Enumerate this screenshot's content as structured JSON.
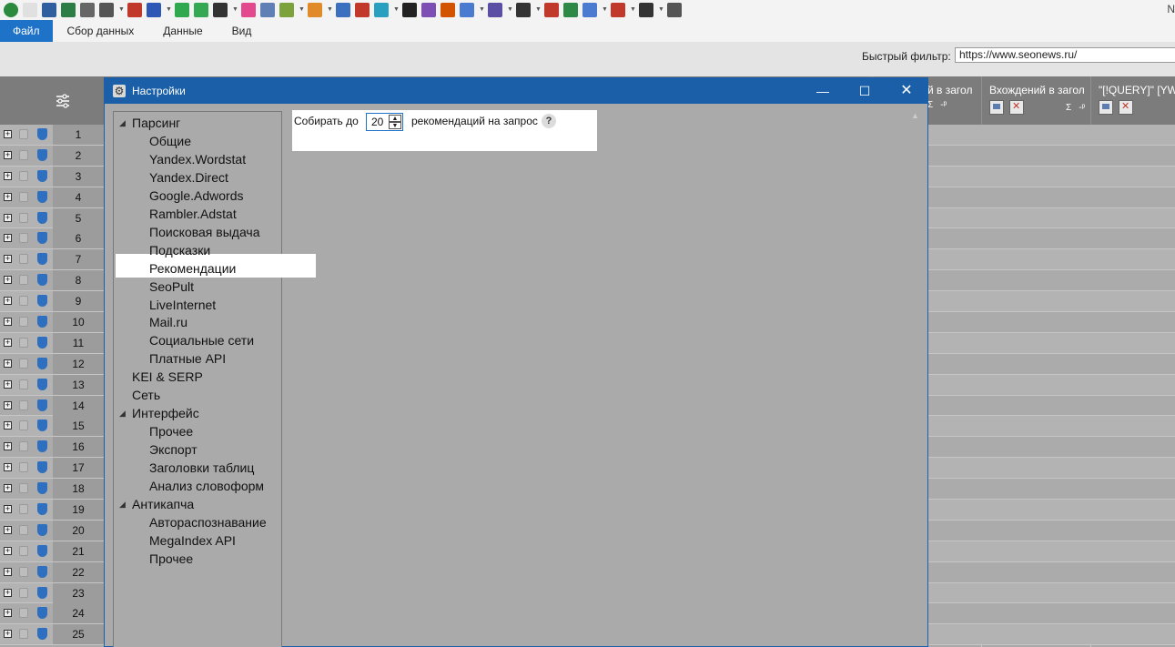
{
  "toolbar": {
    "icons": [
      {
        "name": "app-drop-icon",
        "color": "#2b8a3e"
      },
      {
        "name": "new-file-icon",
        "color": "#e0e0e0"
      },
      {
        "name": "save-icon",
        "color": "#2f5f9e"
      },
      {
        "name": "excel-icon",
        "color": "#2d7d46"
      },
      {
        "name": "settings-icon",
        "color": "#666666"
      },
      {
        "name": "magic-wand-icon",
        "color": "#555555"
      },
      {
        "name": "bar-chart-red-icon",
        "color": "#c0392b"
      },
      {
        "name": "bar-chart-blue-icon",
        "color": "#2d58b5"
      },
      {
        "name": "add-circle-icon",
        "color": "#2fa84f"
      },
      {
        "name": "google-g-icon",
        "color": "#34a853"
      },
      {
        "name": "r-icon",
        "color": "#333333"
      },
      {
        "name": "colors-icon",
        "color": "#e24a8d"
      },
      {
        "name": "image-icon",
        "color": "#5f7fb5"
      },
      {
        "name": "target-icon",
        "color": "#7ca33b"
      },
      {
        "name": "hand-icon",
        "color": "#e08a2a"
      },
      {
        "name": "shield-check-icon",
        "color": "#3b6fc0"
      },
      {
        "name": "block-icon",
        "color": "#c0392b"
      },
      {
        "name": "monitor-icon",
        "color": "#2aa0c0"
      },
      {
        "name": "li-icon",
        "color": "#222222"
      },
      {
        "name": "stats-purple-icon",
        "color": "#7d4fb5"
      },
      {
        "name": "trend-icon",
        "color": "#d35400"
      },
      {
        "name": "google-g2-icon",
        "color": "#4a7bd0"
      },
      {
        "name": "d-icon",
        "color": "#5b4fa5"
      },
      {
        "name": "qr-icon",
        "color": "#333333"
      },
      {
        "name": "funnel-icon",
        "color": "#c0392b"
      },
      {
        "name": "grid-color-icon",
        "color": "#2d8a46"
      },
      {
        "name": "link-icon",
        "color": "#4a7bd0"
      },
      {
        "name": "flag-icon",
        "color": "#c0392b"
      },
      {
        "name": "search-icon",
        "color": "#333333"
      },
      {
        "name": "chart-window-icon",
        "color": "#555555"
      }
    ],
    "corner_text": "N"
  },
  "menu": {
    "items": [
      "Файл",
      "Сбор данных",
      "Данные",
      "Вид"
    ]
  },
  "filter": {
    "label": "Быстрый фильтр:",
    "value": "https://www.seonews.ru/"
  },
  "grid": {
    "columns": [
      {
        "title": "й в загол"
      },
      {
        "title": "Вхождений в загол"
      },
      {
        "title": "\"[!QUERY]\" [YW]"
      }
    ],
    "sigma": "Σ",
    "pin": "-ᵖ",
    "rows": [
      "1",
      "2",
      "3",
      "4",
      "5",
      "6",
      "7",
      "8",
      "9",
      "10",
      "11",
      "12",
      "13",
      "14",
      "15",
      "16",
      "17",
      "18",
      "19",
      "20",
      "21",
      "22",
      "23",
      "24",
      "25"
    ]
  },
  "dialog": {
    "title": "Настройки",
    "minimize": "—",
    "maximize": "☐",
    "close": "✕",
    "tree": {
      "parsing": "Парсинг",
      "parsing_items": [
        "Общие",
        "Yandex.Wordstat",
        "Yandex.Direct",
        "Google.Adwords",
        "Rambler.Adstat",
        "Поисковая выдача",
        "Подсказки",
        "Рекомендации",
        "SeoPult",
        "LiveInternet",
        "Mail.ru",
        "Социальные сети",
        "Платные API"
      ],
      "kei_serp": "KEI & SERP",
      "network": "Сеть",
      "interface": "Интерфейс",
      "interface_items": [
        "Прочее",
        "Экспорт",
        "Заголовки таблиц",
        "Анализ словоформ"
      ],
      "anticaptcha": "Антикапча",
      "anticaptcha_items": [
        "Автораспознавание",
        "MegaIndex API",
        "Прочее"
      ],
      "selected": "Рекомендации"
    },
    "params": {
      "collect_label": "Собирать до",
      "collect_value": "20",
      "per_query_label": "рекомендаций на запрос",
      "help": "?"
    }
  }
}
